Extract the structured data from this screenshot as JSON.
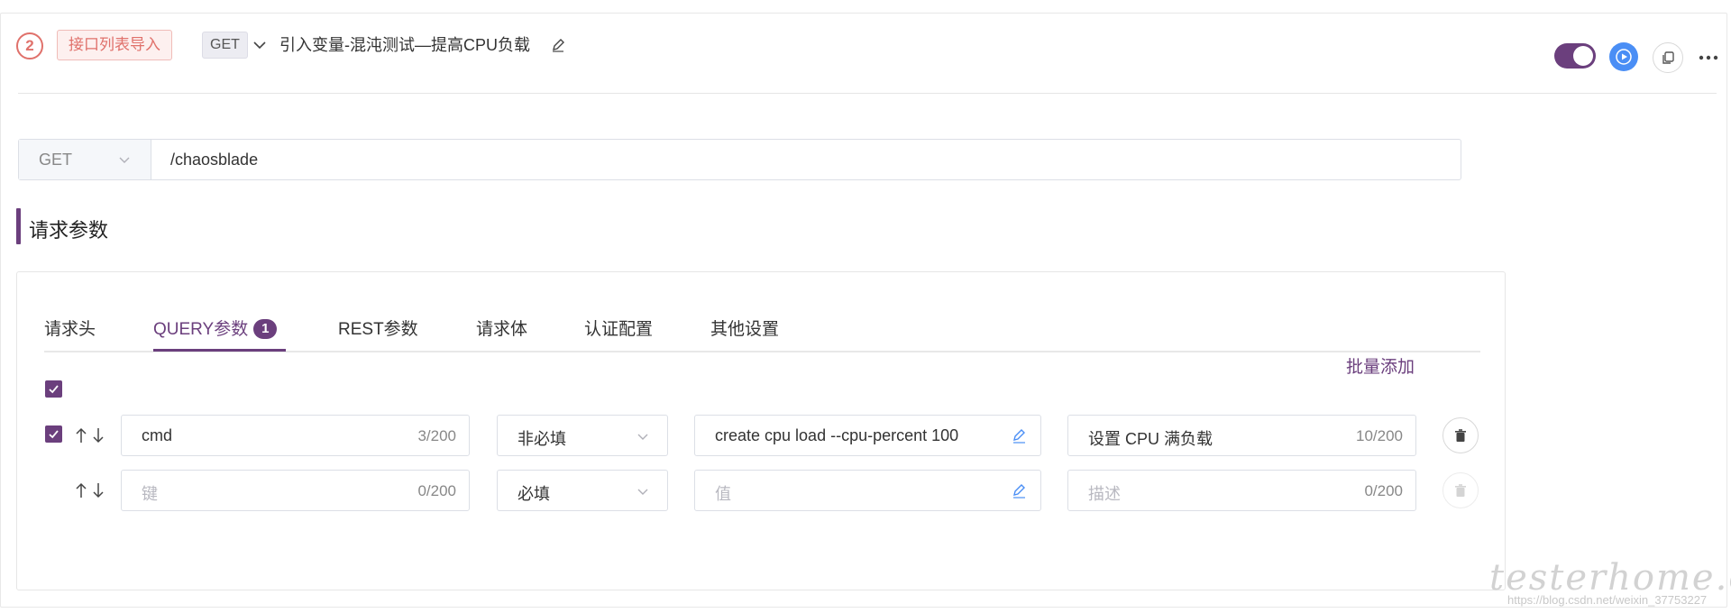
{
  "step": {
    "number": "2",
    "source_badge": "接口列表导入",
    "method": "GET",
    "title": "引入变量-混沌测试—提高CPU负载",
    "enabled": true
  },
  "request": {
    "method": "GET",
    "url": "/chaosblade"
  },
  "section_title": "请求参数",
  "tabs": [
    {
      "label": "请求头"
    },
    {
      "label": "QUERY参数",
      "count": "1",
      "active": true
    },
    {
      "label": "REST参数"
    },
    {
      "label": "请求体"
    },
    {
      "label": "认证配置"
    },
    {
      "label": "其他设置"
    }
  ],
  "bulk_add_label": "批量添加",
  "params": [
    {
      "checked": true,
      "key": "cmd",
      "key_count": "3/200",
      "required": "非必填",
      "value": "create cpu load --cpu-percent 100",
      "description": "设置 CPU 满负载",
      "desc_count": "10/200"
    },
    {
      "checked": false,
      "key_placeholder": "键",
      "key_count": "0/200",
      "required": "必填",
      "value_placeholder": "值",
      "description_placeholder": "描述",
      "desc_count": "0/200"
    }
  ],
  "watermark": {
    "brand": "testerhome.com",
    "url": "https://blog.csdn.net/weixin_37753227"
  },
  "colors": {
    "accent": "#6b3f7d",
    "badge_red": "#e0716b",
    "run_blue": "#4a8ef5"
  }
}
